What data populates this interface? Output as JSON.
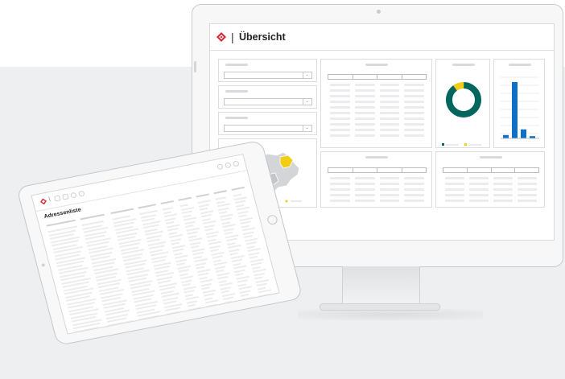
{
  "monitor": {
    "title": "Übersicht",
    "title_separator": "|",
    "dropdown_chevron": "⌄",
    "colors": {
      "accent": "#d62b3a",
      "teal": "#00665e",
      "yellow": "#f3cc14",
      "blue": "#0f6fc6",
      "purple": "#9b94d6"
    },
    "donut": {
      "segments": [
        {
          "label": "",
          "value": 0.9,
          "color": "#00665e"
        },
        {
          "label": "",
          "value": 0.1,
          "color": "#f3cc14"
        }
      ]
    },
    "bars": {
      "values": [
        6,
        100,
        16,
        4
      ],
      "color": "#0f6fc6"
    },
    "map_legend_colors": [
      "#d4d5d8",
      "#9b94d6",
      "#f3cc14"
    ]
  },
  "tablet": {
    "title": "Adressenliste",
    "title_separator": "|"
  }
}
